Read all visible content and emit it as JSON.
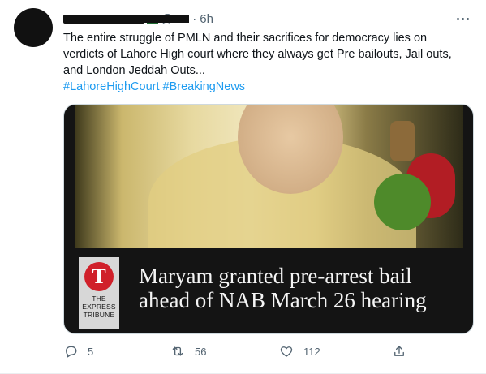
{
  "tweet": {
    "time": "6h",
    "separator": "·",
    "handle": "@",
    "text_lines": [
      "The entire struggle of PMLN and their sacrifices for democracy lies on",
      "verdicts of Lahore High court where they always get Pre bailouts, Jail outs,",
      "and London Jeddah Outs..."
    ],
    "hashtags": [
      "#LahoreHighCourt",
      "#BreakingNews"
    ]
  },
  "media": {
    "logo_letter": "T",
    "logo_lines": [
      "THE",
      "EXPRESS",
      "TRIBUNE"
    ],
    "headline_lines": [
      "Maryam granted pre-arrest bail",
      "ahead of NAB March 26 hearing"
    ]
  },
  "actions": {
    "replies": "5",
    "retweets": "56",
    "likes": "112"
  },
  "colors": {
    "link": "#1d9bf0",
    "secondary_text": "#536471",
    "logo_red": "#d0202a"
  }
}
